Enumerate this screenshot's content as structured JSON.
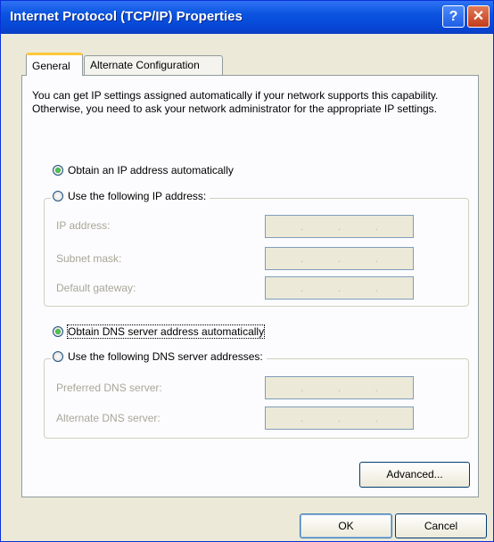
{
  "window": {
    "title": "Internet Protocol (TCP/IP) Properties",
    "help_icon": "?",
    "close_icon": "✕",
    "accent_color": "#0a54e0"
  },
  "tabs": [
    {
      "label": "General",
      "selected": true
    },
    {
      "label": "Alternate Configuration",
      "selected": false
    }
  ],
  "description": "You can get IP settings assigned automatically if your network supports this capability. Otherwise, you need to ask your network administrator for the appropriate IP settings.",
  "ip": {
    "auto_label": "Obtain an IP address automatically",
    "manual_label": "Use the following IP address:",
    "selected": "auto",
    "fields": [
      {
        "label": "IP address:",
        "value": ". . ."
      },
      {
        "label": "Subnet mask:",
        "value": ". . ."
      },
      {
        "label": "Default gateway:",
        "value": ". . ."
      }
    ]
  },
  "dns": {
    "auto_label": "Obtain DNS server address automatically",
    "manual_label": "Use the following DNS server addresses:",
    "selected": "auto",
    "fields": [
      {
        "label": "Preferred DNS server:",
        "value": ". . ."
      },
      {
        "label": "Alternate DNS server:",
        "value": ". . ."
      }
    ]
  },
  "buttons": {
    "advanced": "Advanced...",
    "ok": "OK",
    "cancel": "Cancel"
  }
}
